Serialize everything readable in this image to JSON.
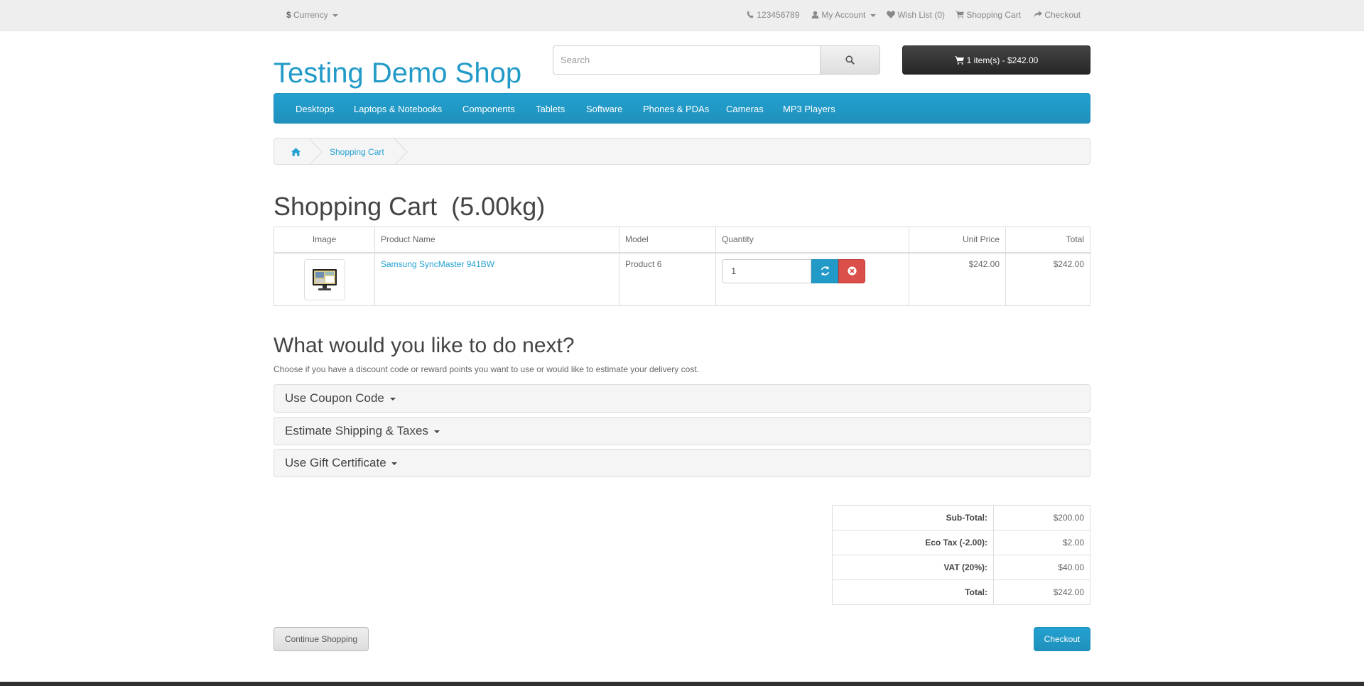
{
  "topbar": {
    "currency_symbol": "$",
    "currency_label": "Currency",
    "phone": "123456789",
    "my_account": "My Account",
    "wish_list": "Wish List (0)",
    "shopping_cart": "Shopping Cart",
    "checkout": "Checkout"
  },
  "header": {
    "logo": "Testing Demo Shop",
    "search_placeholder": "Search",
    "cart_button": "1 item(s) - $242.00"
  },
  "nav": {
    "items": [
      "Desktops",
      "Laptops & Notebooks",
      "Components",
      "Tablets",
      "Software",
      "Phones & PDAs",
      "Cameras",
      "MP3 Players"
    ]
  },
  "breadcrumb": {
    "current": "Shopping Cart"
  },
  "page": {
    "title": "Shopping Cart  (5.00kg)"
  },
  "cart_table": {
    "headers": [
      "Image",
      "Product Name",
      "Model",
      "Quantity",
      "Unit Price",
      "Total"
    ],
    "rows": [
      {
        "product_name": "Samsung SyncMaster 941BW",
        "model": "Product 6",
        "quantity": "1",
        "unit_price": "$242.00",
        "total": "$242.00"
      }
    ]
  },
  "next": {
    "heading": "What would you like to do next?",
    "description": "Choose if you have a discount code or reward points you want to use or would like to estimate your delivery cost.",
    "panels": [
      "Use Coupon Code",
      "Estimate Shipping & Taxes",
      "Use Gift Certificate"
    ]
  },
  "totals": [
    {
      "label": "Sub-Total:",
      "value": "$200.00"
    },
    {
      "label": "Eco Tax (-2.00):",
      "value": "$2.00"
    },
    {
      "label": "VAT (20%):",
      "value": "$40.00"
    },
    {
      "label": "Total:",
      "value": "$242.00"
    }
  ],
  "buttons": {
    "continue_shopping": "Continue Shopping",
    "checkout": "Checkout"
  },
  "colors": {
    "accent": "#229ac8",
    "danger": "#da4f49",
    "dark_button": "#363636",
    "footer": "#303030"
  },
  "icons": [
    "phone-icon",
    "user-icon",
    "heart-icon",
    "cart-icon",
    "share-icon",
    "search-icon",
    "home-icon",
    "refresh-icon",
    "remove-icon",
    "monitor-image"
  ]
}
